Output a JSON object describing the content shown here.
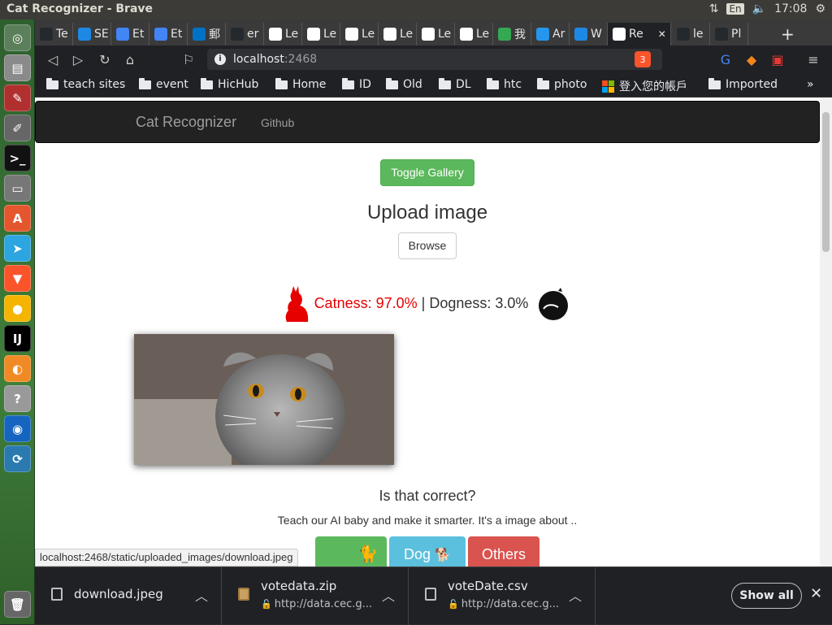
{
  "window": {
    "title": "Cat Recognizer - Brave",
    "lang": "En",
    "time": "17:08"
  },
  "tabs": [
    {
      "label": "Te",
      "color": "#24292e"
    },
    {
      "label": "SE",
      "color": "#1e88e5"
    },
    {
      "label": "Et",
      "color": "#4285f4"
    },
    {
      "label": "Et",
      "color": "#4285f4"
    },
    {
      "label": "郵",
      "color": "#0072c6"
    },
    {
      "label": "er",
      "color": "#24292e"
    },
    {
      "label": "Le",
      "color": "#ffffff"
    },
    {
      "label": "Le",
      "color": "#ffffff"
    },
    {
      "label": "Le",
      "color": "#ffffff"
    },
    {
      "label": "Le",
      "color": "#ffffff"
    },
    {
      "label": "Le",
      "color": "#ffffff"
    },
    {
      "label": "Le",
      "color": "#ffffff"
    },
    {
      "label": "我",
      "color": "#34a853"
    },
    {
      "label": "Ar",
      "color": "#2496ed"
    },
    {
      "label": "W",
      "color": "#1e88e5"
    },
    {
      "label": "Re",
      "color": "#ffffff"
    },
    {
      "label": "le",
      "color": "#24292e"
    },
    {
      "label": "Pl",
      "color": "#24292e"
    }
  ],
  "address": {
    "host": "localhost",
    "port": ":2468",
    "brave_badge": "3"
  },
  "bookmarks": [
    "teach sites",
    "event",
    "HicHub",
    "Home",
    "ID",
    "Old",
    "DL",
    "htc",
    "photo",
    "登入您的帳戶",
    "Imported"
  ],
  "page": {
    "brand": "Cat Recognizer",
    "github": "Github",
    "toggle_gallery": "Toggle Gallery",
    "upload_title": "Upload image",
    "browse": "Browse",
    "catness": "Catness: 97.0%",
    "separator": " | ",
    "dogness": "Dogness: 3.0%",
    "question": "Is that correct?",
    "teach": "Teach our AI baby and make it smarter. It's a image about ..",
    "vote_buttons": [
      {
        "label": "",
        "color": "#5cb85c"
      },
      {
        "label": "Dog",
        "color": "#5bc0de"
      },
      {
        "label": "Others",
        "color": "#d9534f"
      }
    ]
  },
  "status_url": "localhost:2468/static/uploaded_images/download.jpeg",
  "downloads": [
    {
      "name": "download.jpeg",
      "source": ""
    },
    {
      "name": "votedata.zip",
      "source": "http://data.cec.g..."
    },
    {
      "name": "voteDate.csv",
      "source": "http://data.cec.g..."
    }
  ],
  "shelf": {
    "show_all": "Show all"
  }
}
